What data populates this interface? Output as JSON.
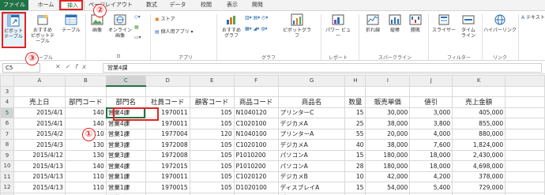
{
  "tabs": [
    "ファイル",
    "ホーム",
    "挿入",
    "ページレイアウト",
    "数式",
    "データ",
    "校閲",
    "表示",
    "開発"
  ],
  "ribbon": {
    "pivot_table": "ピボット\nテーブル",
    "recommended_pivot": "おすすめ\nピボットテーブル",
    "table": "テーブル",
    "group_table": "テーブル",
    "image": "画像",
    "online_image": "オンライン\n画像",
    "store": "ストア",
    "my_apps": "個人用アプリ",
    "group_apps": "アプリ",
    "recommended_chart": "おすすめ\nグラフ",
    "pivot_chart": "ピボットグラフ",
    "group_chart": "グラフ",
    "power_view": "パワー ビュー",
    "group_report": "レポート",
    "sparkline_line": "折れ線",
    "sparkline_column": "縦棒",
    "sparkline_winloss": "勝敗",
    "group_sparkline": "スパークライン",
    "slicer": "スライサー",
    "timeline": "タイム\nライン",
    "group_filter": "フィルター",
    "hyperlink": "ハイパーリンク",
    "group_link": "リンク",
    "text": "テキスト"
  },
  "formula_bar": {
    "name_box": "C5",
    "fx": "fx",
    "value": "営業4課"
  },
  "columns": [
    "A",
    "B",
    "C",
    "D",
    "E",
    "F",
    "G",
    "H",
    "I",
    "J",
    "K"
  ],
  "rows": [
    {
      "n": "3",
      "cells": [
        "",
        "",
        "",
        "",
        "",
        "",
        "",
        "",
        "",
        "",
        ""
      ]
    },
    {
      "n": "4",
      "header": true,
      "cells": [
        "売上日",
        "部門コード",
        "部門名",
        "社員コード",
        "顧客コード",
        "商品コード",
        "商品名",
        "数量",
        "販売単価",
        "値引",
        "売上金額"
      ]
    },
    {
      "n": "5",
      "cells": [
        "2015/4/1",
        "140",
        "営業4課",
        "1970011",
        "105",
        "N1040120",
        "プリンターC",
        "15",
        "30,000",
        "3,000",
        "405,000"
      ]
    },
    {
      "n": "6",
      "cells": [
        "2015/4/1",
        "140",
        "営業4課",
        "1970011",
        "105",
        "C1020100",
        "デジカメA",
        "25",
        "38,000",
        "3,800",
        "855,000"
      ]
    },
    {
      "n": "7",
      "cells": [
        "2015/4/2",
        "110",
        "営業1課",
        "1977004",
        "120",
        "N1040100",
        "プリンターA",
        "55",
        "20,000",
        "4,000",
        "880,000"
      ]
    },
    {
      "n": "8",
      "cells": [
        "2015/4/3",
        "130",
        "営業3課",
        "1972008",
        "105",
        "C1020100",
        "デジカメA",
        "40",
        "38,000",
        "7,600",
        "1,824,000"
      ]
    },
    {
      "n": "9",
      "cells": [
        "2015/4/12",
        "130",
        "営業3課",
        "1972008",
        "105",
        "P1010200",
        "パソコンA",
        "15",
        "180,000",
        "18,000",
        "2,430,000"
      ]
    },
    {
      "n": "10",
      "cells": [
        "2015/4/13",
        "140",
        "営業4課",
        "1972015",
        "105",
        "P1010200",
        "パソコンA",
        "28",
        "180,000",
        "18,000",
        "4,698,000"
      ]
    },
    {
      "n": "11",
      "cells": [
        "2015/4/13",
        "110",
        "営業1課",
        "1970011",
        "105",
        "C1020120",
        "デジカメB",
        "10",
        "42,000",
        "4,200",
        "378,000"
      ]
    },
    {
      "n": "12",
      "cells": [
        "2015/4/13",
        "110",
        "営業1課",
        "1970015",
        "105",
        "D1020100",
        "ディスプレイA",
        "15",
        "54,000",
        "5,400",
        "729,000"
      ]
    },
    {
      "n": "13",
      "cells": [
        "2015/4/14",
        "130",
        "営業3課",
        "1972010",
        "105",
        "P1010200",
        "パソコンA",
        "15",
        "180,000",
        "18,000",
        "2,430,000"
      ]
    }
  ],
  "callouts": {
    "one": "①",
    "two": "②",
    "three": "③"
  },
  "colors": {
    "accent": "#217346",
    "callout": "#e52222"
  }
}
